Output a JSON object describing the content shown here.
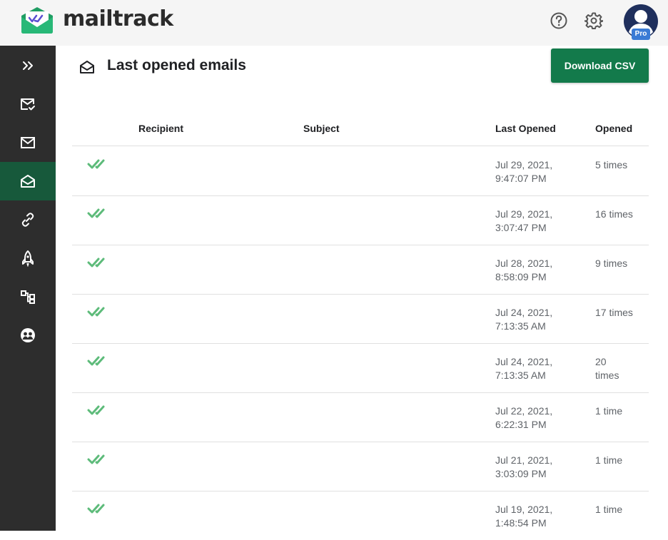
{
  "header": {
    "brand": "mailtrack",
    "badge": "Pro",
    "icons": [
      "help-icon",
      "gear-icon",
      "avatar"
    ]
  },
  "sidebar": {
    "items": [
      {
        "icon": "expand-chevrons-icon"
      },
      {
        "icon": "mail-check-icon"
      },
      {
        "icon": "mail-icon"
      },
      {
        "icon": "mail-open-icon",
        "active": true
      },
      {
        "icon": "link-icon"
      },
      {
        "icon": "rocket-icon"
      },
      {
        "icon": "workflow-icon"
      },
      {
        "icon": "users-icon"
      }
    ]
  },
  "panel": {
    "title": "Last opened emails",
    "download_label": "Download CSV"
  },
  "table": {
    "columns": [
      "Recipient",
      "Subject",
      "Last Opened",
      "Opened"
    ],
    "rows": [
      {
        "date_line1": "Jul 29, 2021,",
        "date_line2": "9:47:07 PM",
        "count_line1": "5 times",
        "count_line2": ""
      },
      {
        "date_line1": "Jul 29, 2021,",
        "date_line2": "3:07:47 PM",
        "count_line1": "16 times",
        "count_line2": ""
      },
      {
        "date_line1": "Jul 28, 2021,",
        "date_line2": "8:58:09 PM",
        "count_line1": "9 times",
        "count_line2": ""
      },
      {
        "date_line1": "Jul 24, 2021,",
        "date_line2": "7:13:35 AM",
        "count_line1": "17 times",
        "count_line2": ""
      },
      {
        "date_line1": "Jul 24, 2021,",
        "date_line2": "7:13:35 AM",
        "count_line1": "20",
        "count_line2": "times"
      },
      {
        "date_line1": "Jul 22, 2021,",
        "date_line2": "6:22:31 PM",
        "count_line1": "1 time",
        "count_line2": ""
      },
      {
        "date_line1": "Jul 21, 2021,",
        "date_line2": "3:03:09 PM",
        "count_line1": "1 time",
        "count_line2": ""
      },
      {
        "date_line1": "Jul 19, 2021,",
        "date_line2": "1:48:54 PM",
        "count_line1": "1 time",
        "count_line2": ""
      }
    ]
  },
  "colors": {
    "brand_green": "#137a4b",
    "check_green": "#5dbb7a",
    "sidebar_bg": "#2d2d2d",
    "sidebar_active": "#17593b",
    "pro_blue": "#3a7bd5"
  }
}
